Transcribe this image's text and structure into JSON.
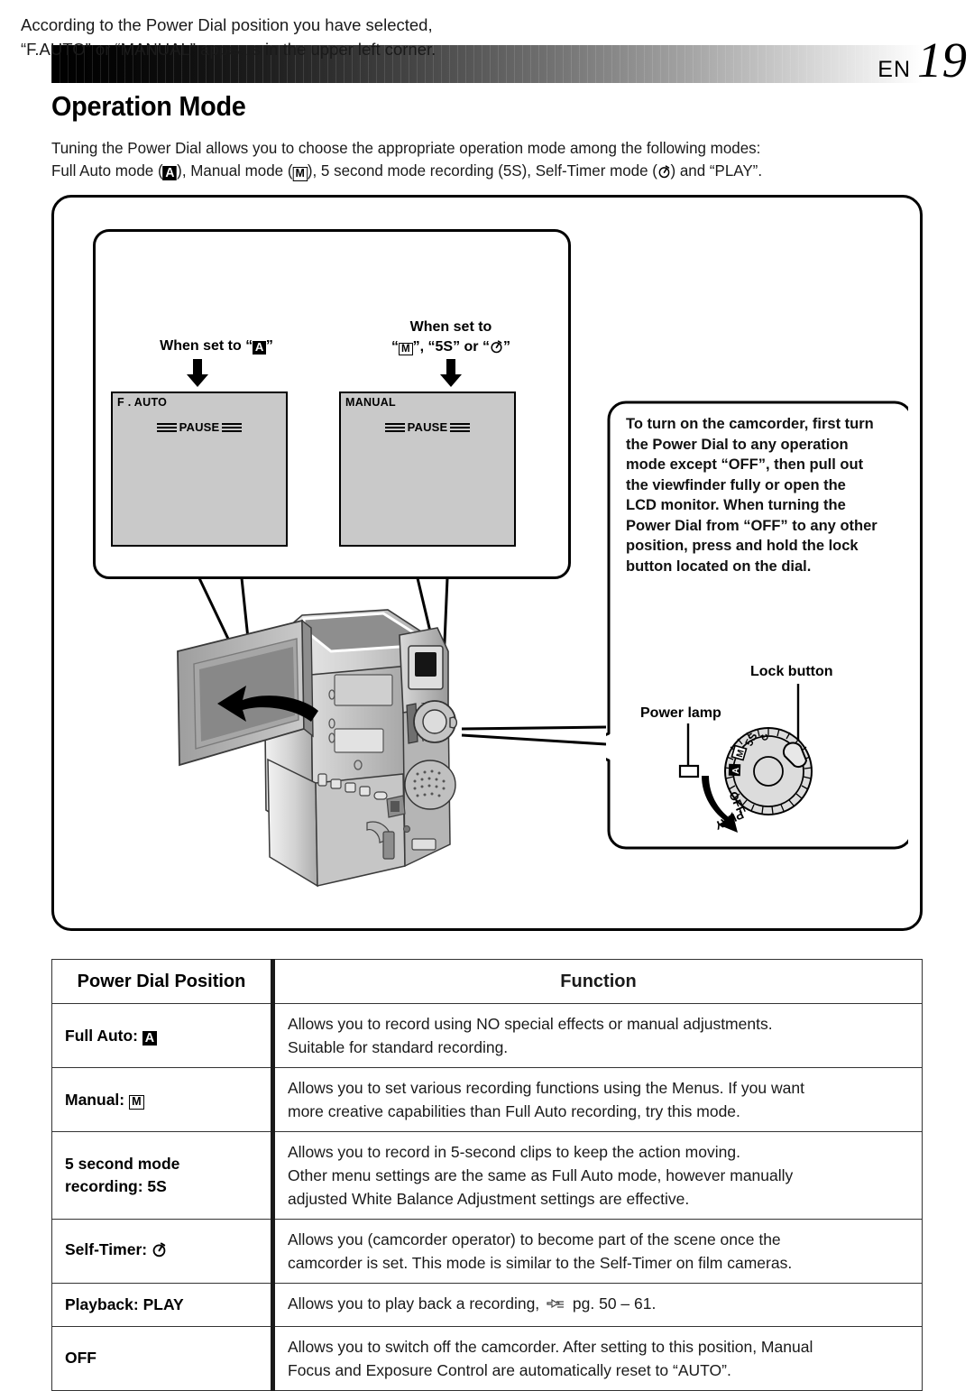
{
  "header": {
    "lang_code": "EN",
    "page_number": "19"
  },
  "page_title": "Operation Mode",
  "intro_line1": "Tuning the Power Dial allows you to choose the appropriate operation mode among the following modes:",
  "intro_line2_a": "Full Auto mode (",
  "intro_line2_b": "), Manual mode (",
  "intro_line2_c": "), 5 second mode recording (5S), Self-Timer mode (",
  "intro_line2_d": ") and “PLAY”.",
  "icons": {
    "full_auto": "A",
    "manual": "M",
    "self_timer": "self-timer-icon",
    "down_arrow": "down-arrow-icon",
    "pointing_hand": "pointing-hand-icon"
  },
  "callout": {
    "body": "According to the Power Dial position you have selected, “F.AUTO” or “MANUAL” appears in the upper left corner.",
    "when_set_to_a_prefix": "When set to “",
    "when_set_to_a_suffix": "”",
    "when_set_to_m_line1": "When set to",
    "when_set_to_m_p1": "“",
    "when_set_to_m_p2": "”, “5S” or “",
    "when_set_to_m_p3": "”"
  },
  "viewfinders": [
    {
      "mode": "F . AUTO",
      "status": "PAUSE"
    },
    {
      "mode": "MANUAL",
      "status": "PAUSE"
    }
  ],
  "note": {
    "text": "To turn on the camcorder, first turn the Power Dial to any operation mode except “OFF”, then pull out the viewfinder fully or open the LCD monitor. When turning the Power Dial from “OFF” to any other position, press and hold the lock button located on the dial."
  },
  "dial": {
    "lock_button_label": "Lock button",
    "power_lamp_label": "Power lamp",
    "positions": [
      "5S",
      "↻",
      "M",
      "A",
      "OFF",
      "PLAY"
    ]
  },
  "table": {
    "headers": [
      "Power Dial Position",
      "Function"
    ],
    "rows": [
      {
        "position_text": "Full Auto: ",
        "position_icon": "full-auto-icon",
        "function_lines": [
          "Allows you to record using NO special effects or manual adjustments.",
          "Suitable for standard recording."
        ]
      },
      {
        "position_text": "Manual: ",
        "position_icon": "manual-icon",
        "function_lines": [
          "Allows you to set various recording functions using the Menus. If you want",
          "more creative capabilities than Full Auto recording, try this mode."
        ]
      },
      {
        "position_text": "5 second mode recording: 5S",
        "position_icon": "",
        "function_lines": [
          "Allows you to record in 5-second clips to keep the action moving.",
          "Other menu settings are the same as Full Auto mode, however manually",
          "adjusted White Balance Adjustment settings are effective."
        ]
      },
      {
        "position_text": "Self-Timer: ",
        "position_icon": "self-timer-icon",
        "function_lines": [
          "Allows you (camcorder operator) to become part of the scene once the",
          "camcorder is set. This mode is similar to the Self-Timer on film cameras."
        ]
      },
      {
        "position_text": "Playback: PLAY",
        "position_icon": "",
        "function_lines": [
          "Allows you to play back a recording,  pg. 50 – 61."
        ],
        "has_hand_icon": true,
        "hand_pre": "Allows you to play back a recording, ",
        "hand_post": " pg. 50 – 61."
      },
      {
        "position_text": "OFF",
        "position_icon": "",
        "function_lines": [
          "Allows you to switch off the camcorder. After setting to this position, Manual",
          "Focus and Exposure Control are automatically reset to “AUTO”."
        ]
      }
    ]
  },
  "colors": {
    "ink": "#1a1a1a",
    "screen_gray": "#c9c9c9",
    "rule": "#333333"
  }
}
